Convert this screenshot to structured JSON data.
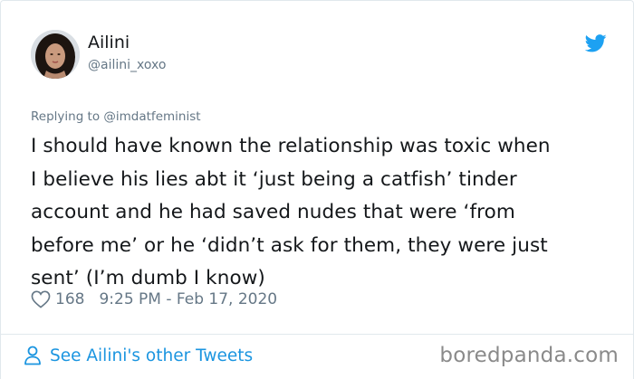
{
  "tweet": {
    "author": {
      "display_name": "Ailini",
      "handle": "@ailini_xoxo"
    },
    "reply_to": "Replying to @imdatfeminist",
    "text_lines": [
      "I should have known the relationship was toxic when",
      "I believe his lies abt it ‘just being a catfish’ tinder",
      "account and he had saved nudes that were ‘from",
      "before me’ or he ‘didn’t ask for them, they were just",
      "sent’ (I’m dumb I know)"
    ],
    "likes": "168",
    "timestamp": "9:25 PM - Feb 17, 2020"
  },
  "footer": {
    "see_more": "See Ailini's other Tweets",
    "watermark": "boredpanda.com"
  },
  "icons": {
    "brand": "twitter-bird-icon",
    "like": "heart-icon",
    "profile": "person-icon"
  },
  "colors": {
    "twitter_blue": "#1da1f2",
    "link_blue": "#1b95e0",
    "muted_text": "#657786",
    "primary_text": "#14171a",
    "border": "#e1e8ed"
  }
}
